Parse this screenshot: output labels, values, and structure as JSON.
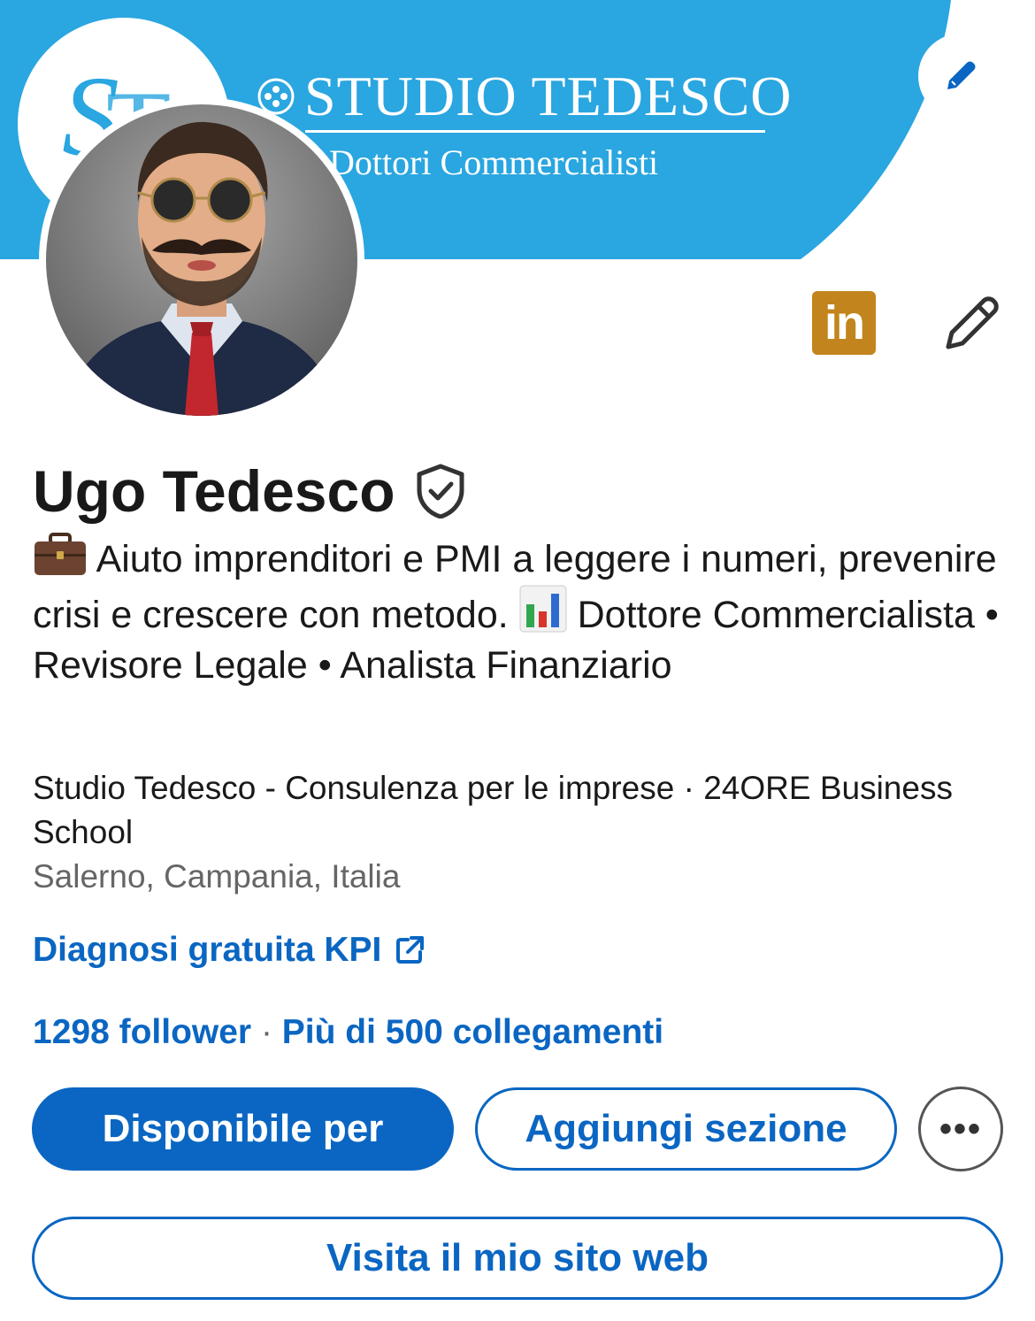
{
  "banner": {
    "title": "STUDIO TEDESCO",
    "subtitle": "Dottori Commerciali­sti",
    "logo_letters": "ST",
    "edit_icon": "pencil-icon",
    "brand_color": "#2aa6e0"
  },
  "profile": {
    "name": "Ugo Tedesco",
    "verified_icon": "shield-check-icon",
    "headline_part1": "Aiuto imprenditori e PMI a leggere i numeri, prevenire crisi e crescere con metodo.",
    "headline_part2": "Dottore Commercialista • Revisore Legale • Analista Finanziario",
    "headline_emojis": [
      "briefcase-icon",
      "bar-chart-icon"
    ],
    "company": "Studio Tedesco - Consulenza per le imprese · 24ORE Business School",
    "location": "Salerno, Campania, Italia",
    "link_text": "Diagnosi gratuita KPI",
    "followers": "1298 follower",
    "stats_separator": "·",
    "connections": "Più di 500 collegamenti",
    "linkedin_badge": "in"
  },
  "actions": {
    "primary": "Disponibile per",
    "secondary": "Aggiungi sezione",
    "more": "•••",
    "website": "Visita il mio sito web"
  },
  "colors": {
    "accent": "#0a66c2",
    "linkedin_badge": "#c2841c",
    "muted_text": "#666666"
  }
}
